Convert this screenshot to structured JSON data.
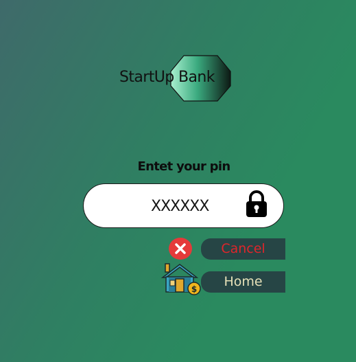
{
  "brand": {
    "name": "StartUp Bank",
    "logo_icon": "hexagon-gradient-icon"
  },
  "pin_form": {
    "prompt": "Entet your pin",
    "masked_value": "XXXXXX",
    "lock_icon": "lock-icon"
  },
  "actions": {
    "cancel_label": "Cancel",
    "cancel_icon": "cancel-x-icon",
    "home_label": "Home",
    "home_icon": "house-coin-icon"
  },
  "colors": {
    "background": "#2a8a5f",
    "button_bg": "#264545",
    "cancel_text": "#e0252b",
    "home_text": "#e6e1b8",
    "cancel_icon": "#e53a3a"
  }
}
